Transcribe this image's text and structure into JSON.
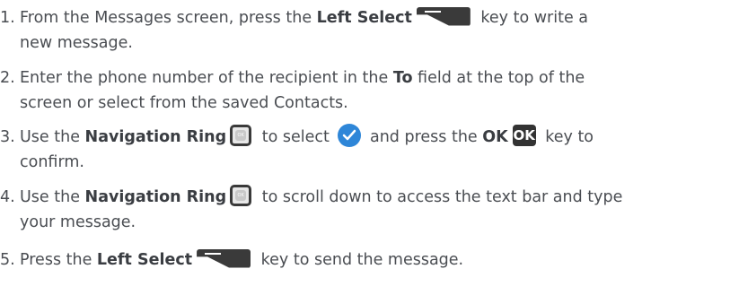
{
  "steps": [
    {
      "number": "1.",
      "line1_pre": "From the Messages screen, press the ",
      "bold1": "Left Select",
      "line1_post": " key to write a",
      "line2": "new message."
    },
    {
      "number": "2.",
      "line1_pre": "Enter the phone number of the recipient in the ",
      "bold1": "To",
      "line1_post": " field at the top of the",
      "line2": "screen or select from the saved Contacts."
    },
    {
      "number": "3.",
      "line1_pre": "Use the ",
      "bold1": "Navigation Ring",
      "mid1": " to select ",
      "mid2": " and press the ",
      "bold2": "OK",
      "line1_post": " key to",
      "line2": "confirm."
    },
    {
      "number": "4.",
      "line1_pre": "Use the ",
      "bold1": "Navigation Ring",
      "line1_post": " to scroll down to access the text bar and type",
      "line2": "your message."
    },
    {
      "number": "5.",
      "line1_pre": "Press the ",
      "bold1": "Left Select",
      "line1_post": " key to send the message."
    }
  ],
  "icons": {
    "ok_key_label": "OK",
    "nav_ring_label": "OK",
    "check_color": "#2e86d8",
    "key_color": "#3a3a3a"
  }
}
